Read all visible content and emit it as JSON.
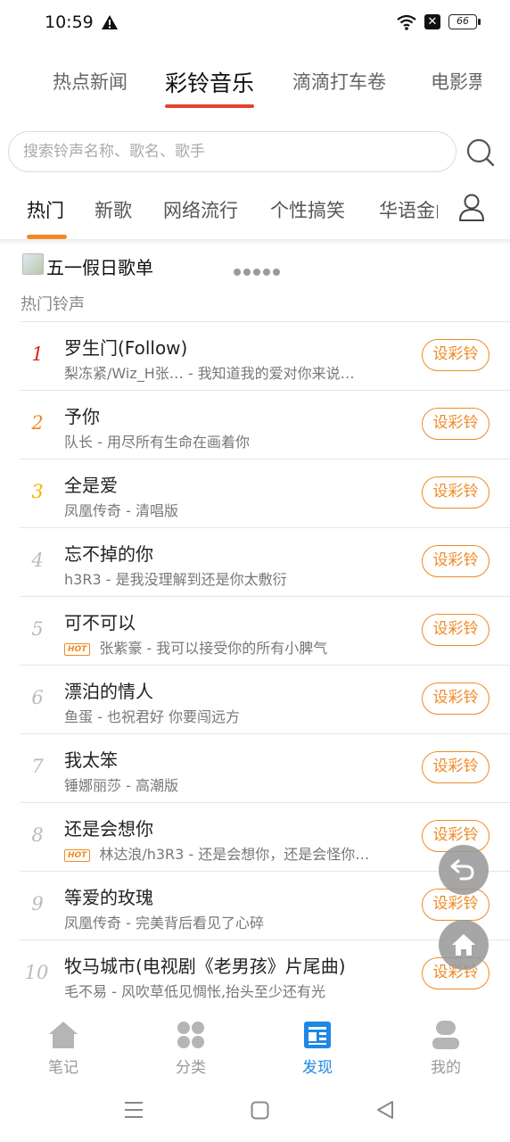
{
  "status_bar": {
    "time": "10:59",
    "battery": "66"
  },
  "top_tabs": [
    {
      "label": "热点新闻",
      "active": false
    },
    {
      "label": "彩铃音乐",
      "active": true
    },
    {
      "label": "滴滴打车卷",
      "active": false
    },
    {
      "label": "电影票",
      "active": false
    }
  ],
  "search": {
    "placeholder": "搜索铃声名称、歌名、歌手",
    "value": ""
  },
  "category_tabs": [
    {
      "label": "热门",
      "active": true
    },
    {
      "label": "新歌",
      "active": false
    },
    {
      "label": "网络流行",
      "active": false
    },
    {
      "label": "个性搞笑",
      "active": false
    },
    {
      "label": "华语金曲",
      "active": false
    }
  ],
  "banner": {
    "title": "五一假日歌单"
  },
  "section_title": "热门铃声",
  "songs": [
    {
      "rank": "1",
      "title": "罗生门(Follow)",
      "subtitle": "梨冻紧/Wiz_H张… - 我知道我的爱对你来说…",
      "hot": false
    },
    {
      "rank": "2",
      "title": "予你",
      "subtitle": "队长 - 用尽所有生命在画着你",
      "hot": false
    },
    {
      "rank": "3",
      "title": "全是爱",
      "subtitle": "凤凰传奇 - 清唱版",
      "hot": false
    },
    {
      "rank": "4",
      "title": "忘不掉的你",
      "subtitle": "h3R3 - 是我没理解到还是你太敷衍",
      "hot": false
    },
    {
      "rank": "5",
      "title": "可不可以",
      "subtitle": "张紫豪 - 我可以接受你的所有小脾气",
      "hot": true
    },
    {
      "rank": "6",
      "title": "漂泊的情人",
      "subtitle": "鱼蛋 - 也祝君好 你要闯远方",
      "hot": false
    },
    {
      "rank": "7",
      "title": "我太笨",
      "subtitle": "锤娜丽莎 - 高潮版",
      "hot": false
    },
    {
      "rank": "8",
      "title": "还是会想你",
      "subtitle": "林达浪/h3R3 - 还是会想你，还是会怪你…",
      "hot": true
    },
    {
      "rank": "9",
      "title": "等爱的玫瑰",
      "subtitle": "凤凰传奇 - 完美背后看见了心碎",
      "hot": false
    },
    {
      "rank": "10",
      "title": "牧马城市(电视剧《老男孩》片尾曲)",
      "subtitle": "毛不易 - 风吹草低见惆怅,抬头至少还有光",
      "hot": false
    }
  ],
  "set_ringtone_label": "设彩铃",
  "hot_tag_label": "HOT",
  "bottom_nav": [
    {
      "label": "笔记",
      "icon": "house-icon",
      "active": false
    },
    {
      "label": "分类",
      "icon": "grid-icon",
      "active": false
    },
    {
      "label": "发现",
      "icon": "discover-icon",
      "active": true
    },
    {
      "label": "我的",
      "icon": "profile-icon",
      "active": false
    }
  ],
  "colors": {
    "accent_orange": "#f08a24",
    "tab_red": "#e4432f",
    "nav_active_blue": "#1e88e5"
  }
}
